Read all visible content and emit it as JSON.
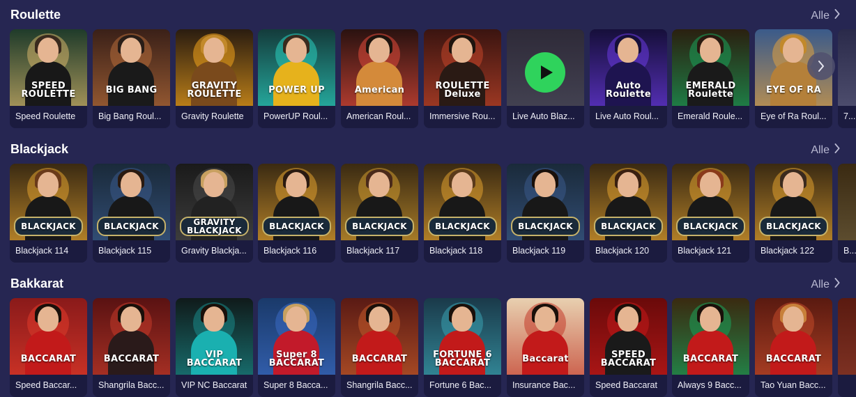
{
  "sections": [
    {
      "title": "Roulette",
      "see_all": "Alle",
      "games": [
        {
          "name": "Speed Roulette",
          "logo": "SPEED ROULETTE",
          "bg": "#1f3b2a",
          "accent": "#d4b36a",
          "hair": "#3a2a1e",
          "torso": "#181818"
        },
        {
          "name": "Big Bang Roul...",
          "logo": "BIG BANG",
          "bg": "#3a2018",
          "accent": "#b46c3a",
          "hair": "#2a1e18",
          "torso": "#1a1a1a"
        },
        {
          "name": "Gravity Roulette",
          "logo": "GRAVITY ROULETTE",
          "bg": "#2a1c10",
          "accent": "#f2a41c",
          "hair": "#c2892b",
          "torso": "#7a4a1c"
        },
        {
          "name": "PowerUP Roul...",
          "logo": "POWER UP",
          "bg": "#143b3b",
          "accent": "#2bd0c0",
          "hair": "#3a2a1e",
          "torso": "#e6b21c"
        },
        {
          "name": "American Roul...",
          "logo": "American",
          "bg": "#2a1210",
          "accent": "#e04a3a",
          "hair": "#1e140e",
          "torso": "#d48a3a"
        },
        {
          "name": "Immersive Rou...",
          "logo": "ROULETTE Deluxe",
          "bg": "#3a1410",
          "accent": "#c2452a",
          "hair": "#1e140e",
          "torso": "#2a1a14"
        },
        {
          "name": "Live Auto Blaz...",
          "logo": "",
          "bg": "#2e2a38",
          "accent": "#4a4a5a",
          "hair": "#2e2a38",
          "torso": "#2e2a38",
          "play": true
        },
        {
          "name": "Live Auto Roul...",
          "logo": "Auto Roulette",
          "bg": "#160f3a",
          "accent": "#6a3ae0",
          "hair": "#160f3a",
          "torso": "#1e1450"
        },
        {
          "name": "Emerald Roule...",
          "logo": "EMERALD Roulette",
          "bg": "#2a2010",
          "accent": "#1aa05a",
          "hair": "#2a1a10",
          "torso": "#1a1a1a"
        },
        {
          "name": "Eye of Ra Roul...",
          "logo": "EYE OF RA",
          "bg": "#3a5a8a",
          "accent": "#e0a040",
          "hair": "#c2892b",
          "torso": "#b4803a"
        },
        {
          "name": "7...",
          "logo": "",
          "bg": "#2a2a4a",
          "accent": "#5a5a7a",
          "hair": "#2a2a4a",
          "torso": "#2a2a4a"
        }
      ]
    },
    {
      "title": "Blackjack",
      "see_all": "Alle",
      "games": [
        {
          "name": "Blackjack 114",
          "logo": "BLACKJACK",
          "bg": "#3a2a12",
          "accent": "#e0a030",
          "hair": "#6a3a1a",
          "torso": "#181818"
        },
        {
          "name": "Blackjack 115",
          "logo": "BLACKJACK",
          "bg": "#1a2a3a",
          "accent": "#3a5a8a",
          "hair": "#2a1a10",
          "torso": "#181818"
        },
        {
          "name": "Gravity Blackja...",
          "logo": "GRAVITY BLACKJACK",
          "bg": "#1a1a1a",
          "accent": "#4a4a4a",
          "hair": "#c8a060",
          "torso": "#222222"
        },
        {
          "name": "Blackjack 116",
          "logo": "BLACKJACK",
          "bg": "#3a2a12",
          "accent": "#e0a030",
          "hair": "#2a1a10",
          "torso": "#181818"
        },
        {
          "name": "Blackjack 117",
          "logo": "BLACKJACK",
          "bg": "#3a2a12",
          "accent": "#d09a30",
          "hair": "#4a2a1a",
          "torso": "#181818"
        },
        {
          "name": "Blackjack 118",
          "logo": "BLACKJACK",
          "bg": "#3a2a12",
          "accent": "#e0a030",
          "hair": "#5a3a1a",
          "torso": "#181818"
        },
        {
          "name": "Blackjack 119",
          "logo": "BLACKJACK",
          "bg": "#1a2a3a",
          "accent": "#3a5a8a",
          "hair": "#1a100a",
          "torso": "#181818"
        },
        {
          "name": "Blackjack 120",
          "logo": "BLACKJACK",
          "bg": "#3a2a12",
          "accent": "#e0a030",
          "hair": "#3a2010",
          "torso": "#181818"
        },
        {
          "name": "Blackjack 121",
          "logo": "BLACKJACK",
          "bg": "#3a2a12",
          "accent": "#e0a030",
          "hair": "#8a3a1a",
          "torso": "#181818"
        },
        {
          "name": "Blackjack 122",
          "logo": "BLACKJACK",
          "bg": "#3a2a12",
          "accent": "#e0a030",
          "hair": "#3a2a1e",
          "torso": "#181818"
        },
        {
          "name": "B...",
          "logo": "",
          "bg": "#3a2a12",
          "accent": "#6a5a3a",
          "hair": "#3a2a12",
          "torso": "#3a2a12"
        }
      ]
    },
    {
      "title": "Bakkarat",
      "see_all": "Alle",
      "games": [
        {
          "name": "Speed Baccar...",
          "logo": "BACCARAT",
          "bg": "#8a1a1a",
          "accent": "#e03a2a",
          "hair": "#1a100a",
          "torso": "#c21a1a"
        },
        {
          "name": "Shangrila Bacc...",
          "logo": "BACCARAT",
          "bg": "#5a1212",
          "accent": "#c23a2a",
          "hair": "#1a100a",
          "torso": "#2a1a1a"
        },
        {
          "name": "VIP NC Baccarat",
          "logo": "VIP BACCARAT",
          "bg": "#101a1a",
          "accent": "#1a8a8a",
          "hair": "#1a100a",
          "torso": "#1ab0b0"
        },
        {
          "name": "Super 8 Bacca...",
          "logo": "Super 8 BACCARAT",
          "bg": "#1a3a6a",
          "accent": "#3a6ac2",
          "hair": "#c8a060",
          "torso": "#c21a2a"
        },
        {
          "name": "Shangrila Bacc...",
          "logo": "BACCARAT",
          "bg": "#5a1a14",
          "accent": "#c25a2a",
          "hair": "#1a100a",
          "torso": "#c21a1a"
        },
        {
          "name": "Fortune 6 Bac...",
          "logo": "FORTUNE 6 BACCARAT",
          "bg": "#1a3a4a",
          "accent": "#3aa0b0",
          "hair": "#1a100a",
          "torso": "#c21a1a"
        },
        {
          "name": "Insurance Bac...",
          "logo": "Baccarat",
          "bg": "#e8d0b0",
          "accent": "#c23a2a",
          "hair": "#1a100a",
          "torso": "#c21a1a"
        },
        {
          "name": "Speed Baccarat",
          "logo": "SPEED BACCARAT",
          "bg": "#6a0a0a",
          "accent": "#c21a1a",
          "hair": "#1a100a",
          "torso": "#1a1a1a"
        },
        {
          "name": "Always 9 Bacc...",
          "logo": "BACCARAT",
          "bg": "#3a2a10",
          "accent": "#1aa05a",
          "hair": "#1a100a",
          "torso": "#c21a1a"
        },
        {
          "name": "Tao Yuan Bacc...",
          "logo": "BACCARAT",
          "bg": "#5a1a10",
          "accent": "#c24a2a",
          "hair": "#c8803a",
          "torso": "#c21a1a"
        },
        {
          "name": "",
          "logo": "",
          "bg": "#5a1a10",
          "accent": "#8a3a2a",
          "hair": "#5a1a10",
          "torso": "#5a1a10"
        }
      ]
    }
  ]
}
